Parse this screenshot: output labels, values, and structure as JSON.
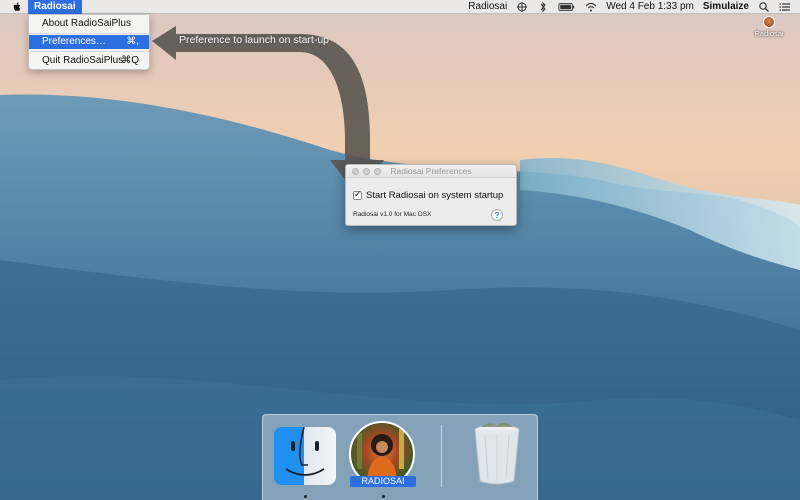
{
  "menubar": {
    "app_name": "Radiosai",
    "status_app": "Radiosai",
    "datetime": "Wed 4 Feb  1:33 pm",
    "user": "Simulaize"
  },
  "dropdown": {
    "items": [
      {
        "label": "About RadioSaiPlus",
        "shortcut": ""
      },
      {
        "label": "Preferences…",
        "shortcut": "⌘,"
      },
      {
        "label": "Quit RadioSaiPlus",
        "shortcut": "⌘Q"
      }
    ]
  },
  "annotation": {
    "text": "Preference to launch on start-up"
  },
  "prefs_window": {
    "title": "Radiosai Preferences",
    "checkbox_label": "Start Radiosai on system startup",
    "checkbox_checked": true,
    "version": "Radiosai v1.0 for Mac OSX",
    "help": "?"
  },
  "desktop_icon": {
    "label": "Radiosai"
  },
  "dock": {
    "radiosai_label": "RADIOSAI"
  },
  "colors": {
    "accent": "#2d6fe0",
    "arrow": "#5a5550"
  },
  "icons": [
    "apple-icon",
    "radiosai-menu-icon",
    "bluetooth-icon",
    "battery-icon",
    "wifi-icon",
    "search-icon",
    "list-icon",
    "finder-icon",
    "trash-icon",
    "help-icon"
  ]
}
